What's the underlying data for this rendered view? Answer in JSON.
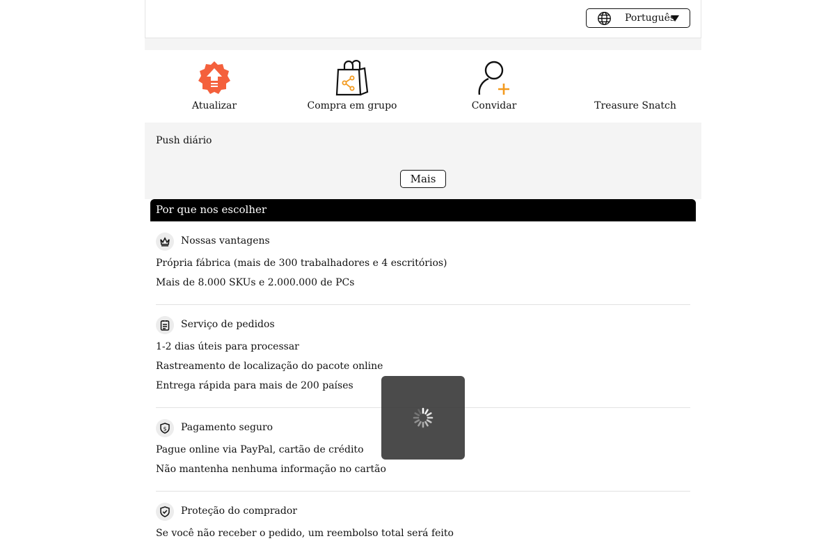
{
  "header": {
    "language": {
      "label": "Português",
      "icon": "globe-icon"
    }
  },
  "quick_actions": [
    {
      "label": "Atualizar",
      "icon": "upgrade-arrow-icon",
      "color": "#f4603c"
    },
    {
      "label": "Compra em grupo",
      "icon": "group-buy-bag-icon",
      "color": "#f39a1e"
    },
    {
      "label": "Convidar",
      "icon": "invite-user-icon",
      "color": "#f39a1e"
    },
    {
      "label": "Treasure Snatch",
      "icon": ""
    }
  ],
  "push": {
    "title": "Push diário",
    "more_label": "Mais"
  },
  "why": {
    "title": "Por que nos escolher",
    "features": [
      {
        "title": "Nossas vantagens",
        "icon": "crown-icon",
        "lines": [
          "Própria fábrica (mais de 300 trabalhadores e 4 escritórios)",
          "Mais de 8.000 SKUs e 2.000.000 de PCs"
        ]
      },
      {
        "title": "Serviço de pedidos",
        "icon": "order-list-icon",
        "lines": [
          "1-2 dias úteis para processar",
          "Rastreamento de localização do pacote online",
          "Entrega rápida para mais de 200 países"
        ]
      },
      {
        "title": "Pagamento seguro",
        "icon": "secure-payment-shield-icon",
        "lines": [
          "Pague online via PayPal, cartão de crédito",
          "Não mantenha nenhuma informação no cartão"
        ]
      },
      {
        "title": "Proteção do comprador",
        "icon": "buyer-protection-shield-icon",
        "lines": [
          "Se você não receber o pedido, um reembolso total será feito"
        ]
      }
    ]
  },
  "loading": {
    "icon": "loading-spinner-icon"
  },
  "colors": {
    "accent_orange": "#f39a1e",
    "upgrade_red": "#f4603c",
    "panel_gray": "#f4f4f4"
  }
}
